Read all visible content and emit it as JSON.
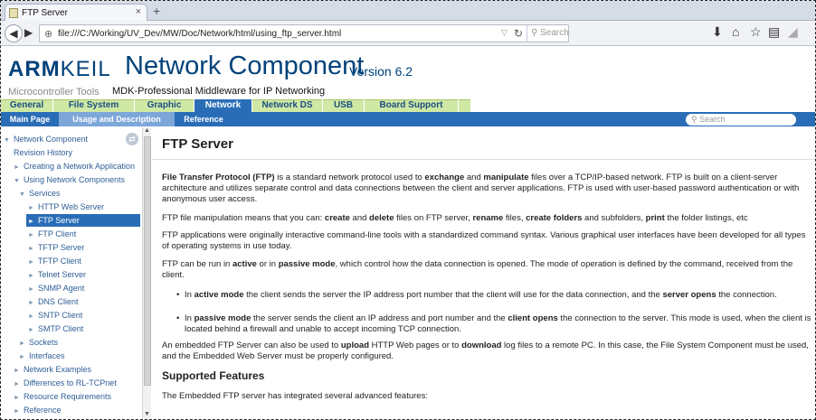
{
  "browser": {
    "tab_title": "FTP Server",
    "tab_close": "×",
    "new_tab": "+",
    "url": "file:///C:/Working/UV_Dev/MW/Doc/Network/html/using_ftp_server.html",
    "search_placeholder": "Search",
    "icons": [
      "back-icon",
      "forward-icon",
      "globe-icon",
      "reload-icon",
      "search-icon",
      "download-icon",
      "home-icon",
      "bookmark-star-icon",
      "bookmarks-list-icon",
      "pocket-icon"
    ]
  },
  "banner": {
    "logo_arm": "ARM",
    "logo_keil": "KEIL",
    "tagline": "Microcontroller Tools",
    "title": "Network Component",
    "version": "Version 6.2",
    "subtitle": "MDK-Professional Middleware for IP Networking"
  },
  "menu1": [
    "General",
    "File System",
    "Graphic",
    "Network",
    "Network DS",
    "USB",
    "Board Support"
  ],
  "menu1_active": "Network",
  "menu2": [
    "Main Page",
    "Usage and Description",
    "Reference"
  ],
  "menu2_active": "Usage and Description",
  "menu2_search_placeholder": "Search",
  "sidebar": [
    {
      "label": "Network Component",
      "level": 0,
      "arrow": "▼"
    },
    {
      "label": "Revision History",
      "level": 1,
      "arrow": ""
    },
    {
      "label": "Creating a Network Application",
      "level": 1,
      "arrow": "►"
    },
    {
      "label": "Using Network Components",
      "level": 1,
      "arrow": "▼"
    },
    {
      "label": "Services",
      "level": 2,
      "arrow": "▼"
    },
    {
      "label": "HTTP Web Server",
      "level": 3,
      "arrow": "►"
    },
    {
      "label": "FTP Server",
      "level": 3,
      "arrow": "►",
      "selected": true
    },
    {
      "label": "FTP Client",
      "level": 3,
      "arrow": "►"
    },
    {
      "label": "TFTP Server",
      "level": 3,
      "arrow": "►"
    },
    {
      "label": "TFTP Client",
      "level": 3,
      "arrow": "►"
    },
    {
      "label": "Telnet Server",
      "level": 3,
      "arrow": "►"
    },
    {
      "label": "SNMP Agent",
      "level": 3,
      "arrow": "►"
    },
    {
      "label": "DNS Client",
      "level": 3,
      "arrow": "►"
    },
    {
      "label": "SNTP Client",
      "level": 3,
      "arrow": "►"
    },
    {
      "label": "SMTP Client",
      "level": 3,
      "arrow": "►"
    },
    {
      "label": "Sockets",
      "level": 2,
      "arrow": "►"
    },
    {
      "label": "Interfaces",
      "level": 2,
      "arrow": "►"
    },
    {
      "label": "Network Examples",
      "level": 1,
      "arrow": "►"
    },
    {
      "label": "Differences to RL-TCPnet",
      "level": 1,
      "arrow": "►"
    },
    {
      "label": "Resource Requirements",
      "level": 1,
      "arrow": "►"
    },
    {
      "label": "Reference",
      "level": 1,
      "arrow": "►"
    }
  ],
  "content": {
    "heading": "FTP Server",
    "p1": [
      {
        "t": "File Transfer Protocol (FTP)",
        "b": true
      },
      {
        "t": " is a standard network protocol used to ",
        "b": false
      },
      {
        "t": "exchange",
        "b": true
      },
      {
        "t": " and ",
        "b": false
      },
      {
        "t": "manipulate",
        "b": true
      },
      {
        "t": " files over a TCP/IP-based network. FTP is built on a client-server architecture and utilizes separate control and data connections between the client and server applications. FTP is used with user-based password authentication or with anonymous user access.",
        "b": false
      }
    ],
    "p2": [
      {
        "t": "FTP file manipulation means that you can: ",
        "b": false
      },
      {
        "t": "create",
        "b": true
      },
      {
        "t": " and ",
        "b": false
      },
      {
        "t": "delete",
        "b": true
      },
      {
        "t": " files on FTP server, ",
        "b": false
      },
      {
        "t": "rename",
        "b": true
      },
      {
        "t": " files, ",
        "b": false
      },
      {
        "t": "create folders",
        "b": true
      },
      {
        "t": " and subfolders, ",
        "b": false
      },
      {
        "t": "print",
        "b": true
      },
      {
        "t": " the folder listings, etc",
        "b": false
      }
    ],
    "p3": "FTP applications were originally interactive command-line tools with a standardized command syntax. Various graphical user interfaces have been developed for all types of operating systems in use today.",
    "p4": [
      {
        "t": "FTP can be run in ",
        "b": false
      },
      {
        "t": "active",
        "b": true
      },
      {
        "t": " or in ",
        "b": false
      },
      {
        "t": "passive mode",
        "b": true
      },
      {
        "t": ", which control how the data connection is opened. The mode of operation is defined by the command, received from the client.",
        "b": false
      }
    ],
    "li1": [
      {
        "t": "In ",
        "b": false
      },
      {
        "t": "active mode",
        "b": true
      },
      {
        "t": " the client sends the server the IP address port number that the client will use for the data connection, and the ",
        "b": false
      },
      {
        "t": "server opens",
        "b": true
      },
      {
        "t": " the connection.",
        "b": false
      }
    ],
    "li2": [
      {
        "t": "In ",
        "b": false
      },
      {
        "t": "passive mode",
        "b": true
      },
      {
        "t": " the server sends the client an IP address and port number and the ",
        "b": false
      },
      {
        "t": "client opens",
        "b": true
      },
      {
        "t": " the connection to the server. This mode is used, when the client is located behind a firewall and unable to accept incoming TCP connection.",
        "b": false
      }
    ],
    "p5": [
      {
        "t": "An embedded FTP Server can also be used to ",
        "b": false
      },
      {
        "t": "upload",
        "b": true
      },
      {
        "t": " HTTP Web pages or to ",
        "b": false
      },
      {
        "t": "download",
        "b": true
      },
      {
        "t": " log files to a remote PC. In this case, the File System Component must be used, and the Embedded Web Server must be properly configured.",
        "b": false
      }
    ],
    "h2": "Supported Features",
    "p6": "The Embedded FTP server has integrated several advanced features:"
  },
  "colors": {
    "brand": "#00427a",
    "menu_green": "#cfe8a4",
    "menu_blue": "#2a6db7",
    "link": "#2e5f95"
  }
}
